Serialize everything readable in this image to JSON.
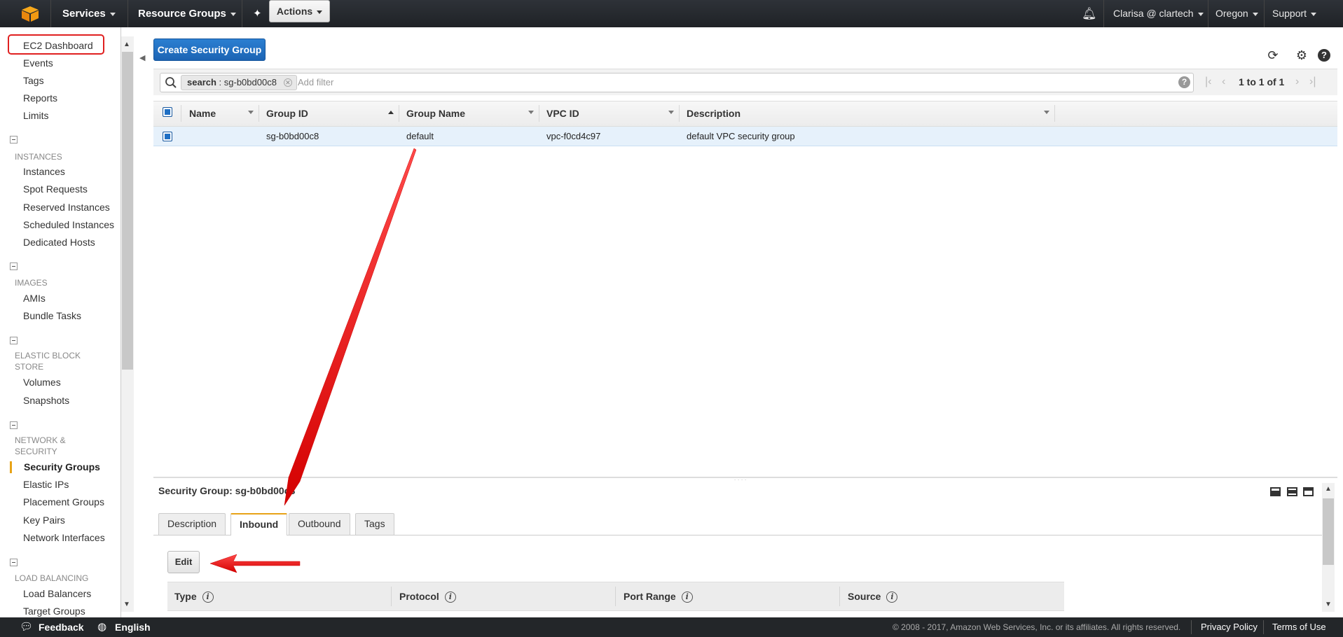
{
  "topnav": {
    "services": "Services",
    "resource_groups": "Resource Groups",
    "user": "Clarisa @ clartech",
    "region": "Oregon",
    "support": "Support"
  },
  "sidebar": {
    "dashboard": "EC2 Dashboard",
    "top_items": [
      "Events",
      "Tags",
      "Reports",
      "Limits"
    ],
    "sections": [
      {
        "title": "INSTANCES",
        "items": [
          "Instances",
          "Spot Requests",
          "Reserved Instances",
          "Scheduled Instances",
          "Dedicated Hosts"
        ]
      },
      {
        "title": "IMAGES",
        "items": [
          "AMIs",
          "Bundle Tasks"
        ]
      },
      {
        "title": "ELASTIC BLOCK STORE",
        "items": [
          "Volumes",
          "Snapshots"
        ]
      },
      {
        "title": "NETWORK & SECURITY",
        "items": [
          "Security Groups",
          "Elastic IPs",
          "Placement Groups",
          "Key Pairs",
          "Network Interfaces"
        ]
      },
      {
        "title": "LOAD BALANCING",
        "items": [
          "Load Balancers",
          "Target Groups"
        ]
      }
    ],
    "active_item": "Security Groups"
  },
  "toolbar": {
    "create_label": "Create Security Group",
    "actions_label": "Actions"
  },
  "filter": {
    "token_key": "search",
    "token_value": "sg-b0bd00c8",
    "placeholder": "Add filter",
    "pagination": "1 to 1 of 1"
  },
  "table": {
    "columns": [
      "Name",
      "Group ID",
      "Group Name",
      "VPC ID",
      "Description"
    ],
    "rows": [
      {
        "name": "",
        "group_id": "sg-b0bd00c8",
        "group_name": "default",
        "vpc_id": "vpc-f0cd4c97",
        "description": "default VPC security group"
      }
    ]
  },
  "details": {
    "title": "Security Group: sg-b0bd00c8",
    "tabs": [
      "Description",
      "Inbound",
      "Outbound",
      "Tags"
    ],
    "active_tab": "Inbound",
    "edit_label": "Edit",
    "rule_columns": [
      "Type",
      "Protocol",
      "Port Range",
      "Source"
    ]
  },
  "footer": {
    "feedback": "Feedback",
    "language": "English",
    "copyright": "© 2008 - 2017, Amazon Web Services, Inc. or its affiliates. All rights reserved.",
    "privacy": "Privacy Policy",
    "terms": "Terms of Use"
  },
  "colors": {
    "primary_button": "#1c64b4",
    "active_tab_accent": "#e8a317",
    "annotation_red": "#e02020",
    "selected_row": "#e6f1fb"
  }
}
